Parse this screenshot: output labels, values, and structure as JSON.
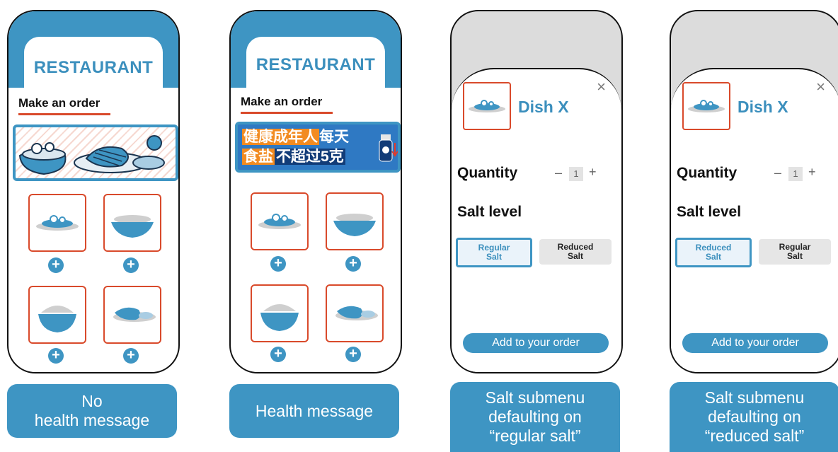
{
  "colors": {
    "accent": "#3e95c3",
    "title_blue": "#3b8fbd",
    "card_border": "#d94a2b",
    "modal_backdrop": "#dcdcdc"
  },
  "panels": [
    {
      "restaurant": "RESTAURANT",
      "make_order": "Make an order",
      "banner": "food-illustration",
      "caption_lines": [
        "No",
        "health message"
      ]
    },
    {
      "restaurant": "RESTAURANT",
      "make_order": "Make an order",
      "banner": "health-message",
      "health_line1_a": "健康成年人",
      "health_line1_b": "每天",
      "health_line2_a": "食盐",
      "health_line2_b": "不超过5克",
      "caption_lines": [
        "Health message"
      ]
    },
    {
      "dish": "Dish X",
      "close": "×",
      "quantity_label": "Quantity",
      "quantity_minus": "–",
      "quantity_value": "1",
      "quantity_plus": "+",
      "salt_label": "Salt level",
      "selected_option": "Regular Salt",
      "other_option": "Reduced Salt",
      "add_button": "Add to your order",
      "caption_lines": [
        "Salt submenu",
        "defaulting on",
        "“regular salt”"
      ]
    },
    {
      "dish": "Dish X",
      "close": "×",
      "quantity_label": "Quantity",
      "quantity_minus": "–",
      "quantity_value": "1",
      "quantity_plus": "+",
      "salt_label": "Salt level",
      "selected_option": "Reduced Salt",
      "other_option": "Regular Salt",
      "add_button": "Add to your order",
      "caption_lines": [
        "Salt submenu",
        "defaulting on",
        "“reduced salt”"
      ]
    }
  ],
  "menu_dish_icons": [
    "seafood-plate-icon",
    "noodle-bowl-icon",
    "rice-bowl-icon",
    "steak-plate-icon"
  ]
}
